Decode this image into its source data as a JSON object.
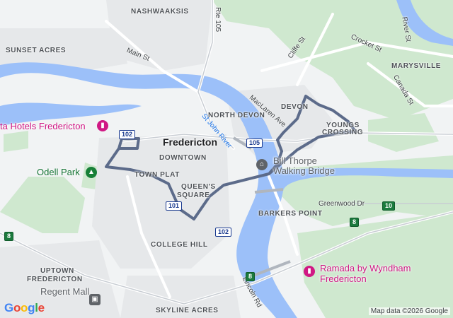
{
  "map": {
    "city_label": "Fredericton",
    "neighborhoods": [
      "NASHWAAKSIS",
      "SUNSET ACRES",
      "NORTH DEVON",
      "DEVON",
      "YOUNGS",
      "CROSSING",
      "MARYSVILLE",
      "DOWNTOWN",
      "TOWN PLAT",
      "QUEEN'S",
      "SQUARE",
      "BARKERS POINT",
      "COLLEGE HILL",
      "UPTOWN",
      "FREDERICTON",
      "SKYLINE ACRES"
    ],
    "streets": [
      "Main St",
      "Rte 105",
      "Cliffe St",
      "Crocket St",
      "River St",
      "Canada St",
      "MacLaren Ave",
      "Greenwood Dr",
      "Lincoln Rd"
    ],
    "water_label": "St John River",
    "pois": {
      "hotel_north": "Delta Hotels Fredericton",
      "hotel_north_visible": "ta Hotels Fredericton",
      "park": "Odell Park",
      "bridge_line1": "Bill Thorpe",
      "bridge_line2": "Walking Bridge",
      "hotel_south_line1": "Ramada by Wyndham",
      "hotel_south_line2": "Fredericton",
      "mall": "Regent Mall"
    },
    "route_shields": {
      "r102a": "102",
      "r105": "105",
      "r101": "101",
      "r102b": "102",
      "r8a": "8",
      "r8b": "8",
      "r8c": "8",
      "r10": "10"
    },
    "attribution": "Map data ©2026 Google",
    "logo_text": "Google",
    "colors": {
      "land": "#f1f3f4",
      "water": "#9cc0f9",
      "park": "#c8e6c9",
      "route": "#5c6b8a",
      "hotel_pin": "#d01884",
      "park_pin": "#188038"
    }
  }
}
